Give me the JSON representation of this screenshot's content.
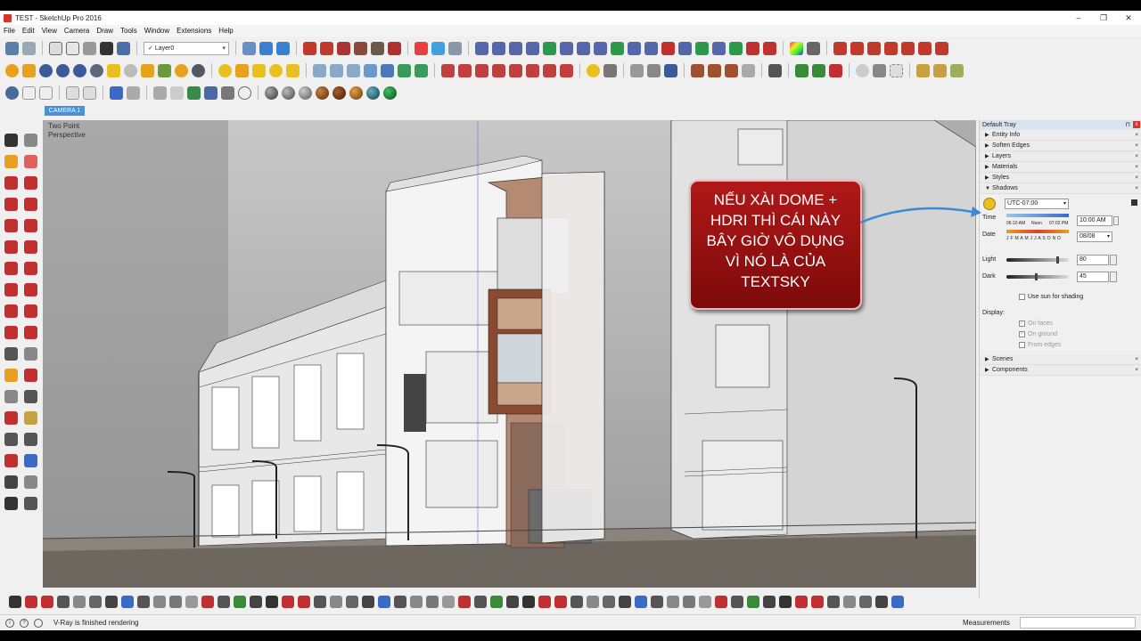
{
  "window": {
    "title": "TEST - SketchUp Pro 2016",
    "controls": [
      "–",
      "❐",
      "✕"
    ]
  },
  "menu": [
    "File",
    "Edit",
    "View",
    "Camera",
    "Draw",
    "Tools",
    "Window",
    "Extensions",
    "Help"
  ],
  "toolbar": {
    "layer_value": "Layer0"
  },
  "scene_tab": "CAMERA 1",
  "viewport": {
    "camera_label_line1": "Two Point",
    "camera_label_line2": "Perspective"
  },
  "callout": {
    "line1": "NẾU XÀI DOME +",
    "line2": "HDRI THÌ CÁI NÀY",
    "line3": "BÂY GIỜ VÔ DỤNG",
    "line4": "VÌ NÓ LÀ CỦA",
    "line5": "TEXTSKY"
  },
  "tray": {
    "title": "Default Tray",
    "pin": "⊓",
    "close": "x",
    "sections_top": [
      "Entity Info",
      "Soften Edges",
      "Layers",
      "Materials",
      "Styles"
    ],
    "shadows": {
      "label": "Shadows",
      "timezone": "UTC-07:00",
      "time_label": "Time",
      "time_start": "06:10 AM",
      "time_noon": "Noon",
      "time_end": "07:02 PM",
      "time_value": "10:00 AM",
      "date_label": "Date",
      "months": "J F M A M J J A S O N D",
      "date_value": "08/08",
      "light_label": "Light",
      "light_value": "80",
      "light_level": 0.8,
      "dark_label": "Dark",
      "dark_value": "45",
      "dark_level": 0.45,
      "use_sun": "Use sun for shading",
      "display_label": "Display:",
      "on_faces": "On faces",
      "on_ground": "On ground",
      "from_edges": "From edges"
    },
    "sections_bottom": [
      "Scenes",
      "Components"
    ]
  },
  "status": {
    "message": "V-Ray is finished rendering",
    "measurements_label": "Measurements"
  },
  "colors": {
    "callout_red": "#9a1212",
    "scene_tab_blue": "#4a90d9",
    "close_red": "#d9342b"
  }
}
